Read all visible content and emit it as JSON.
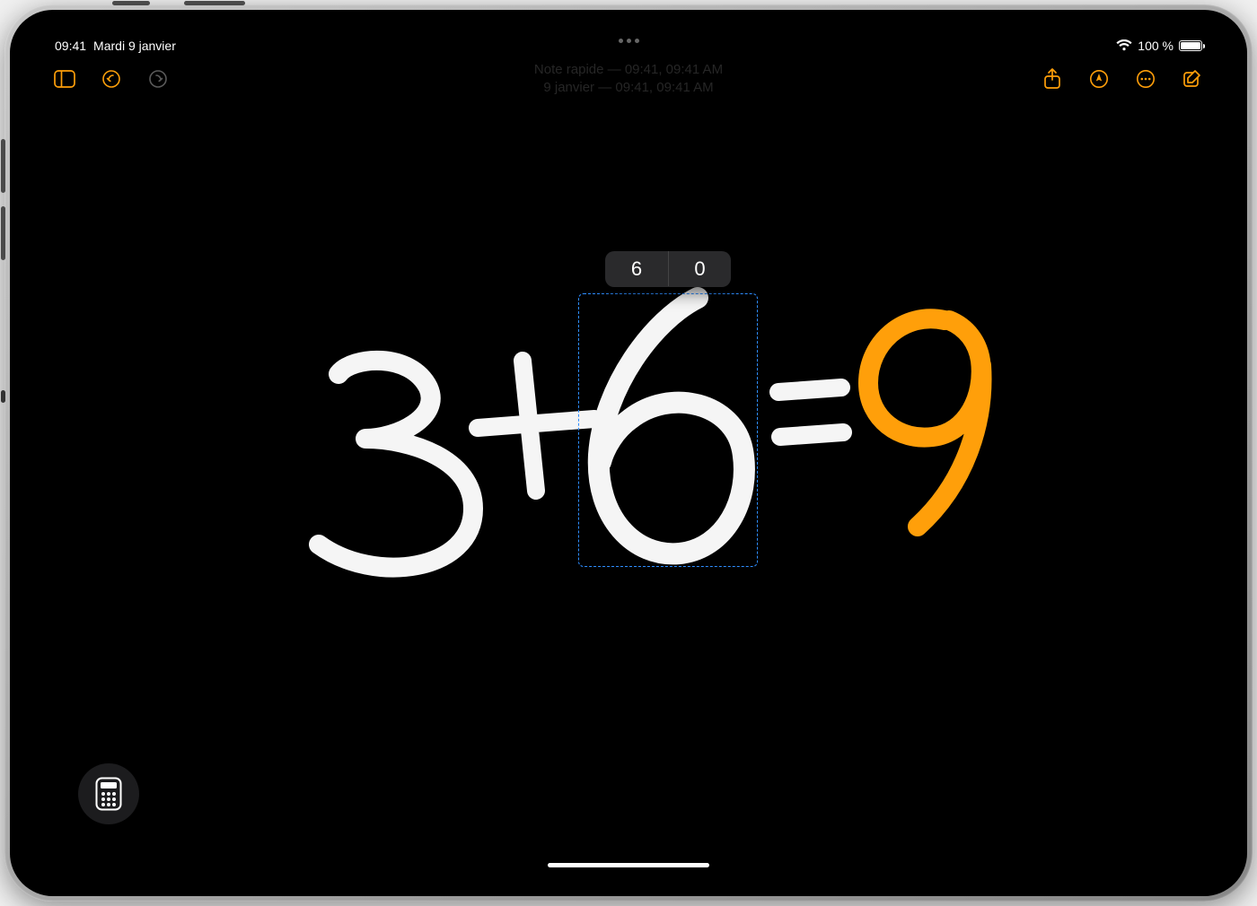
{
  "status": {
    "time": "09:41",
    "date": "Mardi 9 janvier",
    "battery_pct": "100 %"
  },
  "doc_header": {
    "line1": "Note rapide — 09:41, 09:41 AM",
    "line2": "9 janvier — 09:41, 09:41 AM"
  },
  "equation": {
    "a": "3",
    "op": "+",
    "b": "6",
    "eq": "=",
    "result": "9"
  },
  "suggestion": {
    "options": [
      "6",
      "0"
    ]
  },
  "colors": {
    "accent": "#ff9f0a",
    "ink_white": "#f5f5f5",
    "ink_result": "#ff9f0a",
    "selection": "#2e8dff"
  }
}
